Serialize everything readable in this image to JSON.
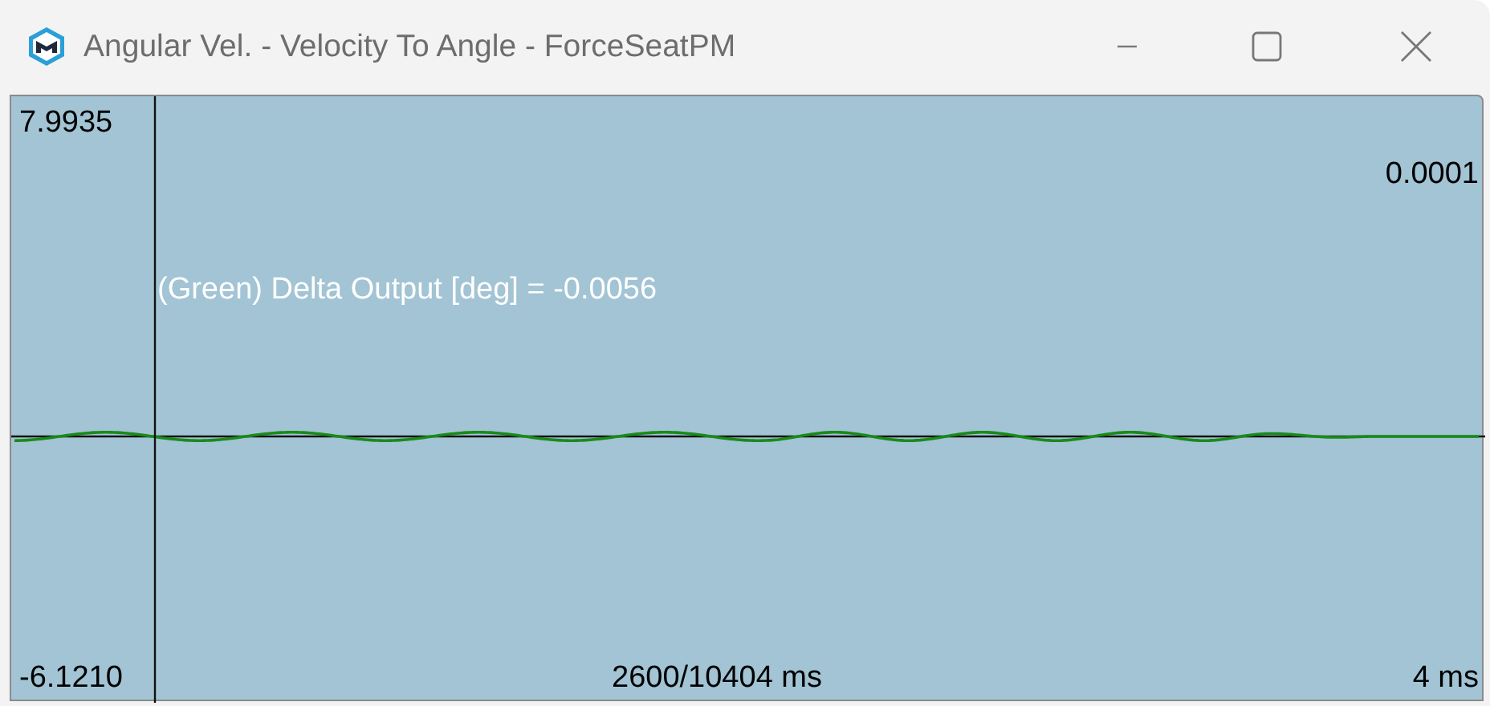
{
  "window": {
    "title": "Angular Vel. - Velocity To Angle - ForceSeatPM"
  },
  "plot": {
    "y_max": "7.9935",
    "right_value": "0.0001",
    "readout": "(Green) Delta Output [deg] = -0.0056",
    "y_min": "-6.1210",
    "time_position": "2600/10404 ms",
    "time_scale": "4 ms"
  }
}
